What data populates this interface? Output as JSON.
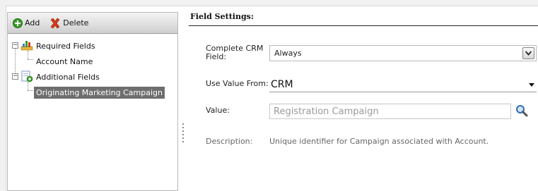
{
  "toolbar": {
    "add_label": "Add",
    "delete_label": "Delete"
  },
  "tree": {
    "required": {
      "label": "Required Fields",
      "children": [
        "Account Name"
      ]
    },
    "additional": {
      "label": "Additional Fields",
      "children": [
        "Originating Marketing Campaign"
      ]
    }
  },
  "settings": {
    "title": "Field Settings:",
    "complete_crm_label": "Complete CRM Field:",
    "complete_crm_value": "Always",
    "use_value_from_label": "Use Value From:",
    "use_value_from_value": "CRM",
    "value_label": "Value:",
    "value_placeholder": "Registration Campaign",
    "description_label": "Description:",
    "description_text": "Unique identifier for Campaign associated with Account."
  },
  "icons": {
    "add": "add-circle-icon",
    "delete": "delete-x-icon",
    "required_fields": "chart-folder-icon",
    "additional_fields": "document-add-icon",
    "search": "search-icon",
    "dropdown": "chevron-down-icon"
  },
  "colors": {
    "selected_bg": "#6e6e6e",
    "add_green": "#3a9a2a",
    "delete_red": "#d33a1a"
  }
}
